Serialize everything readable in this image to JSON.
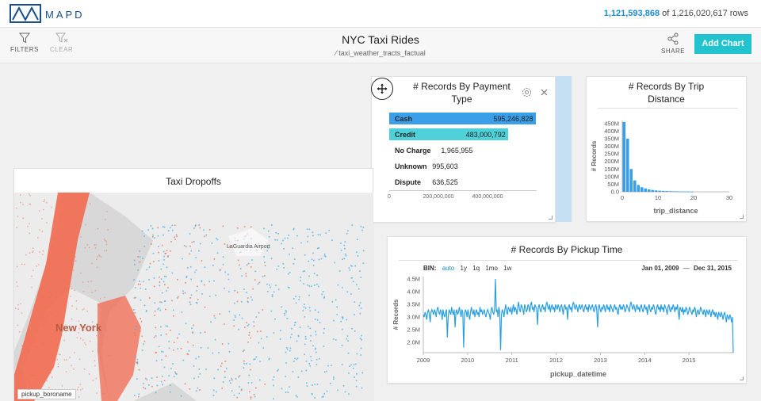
{
  "header": {
    "brand": "MAPD",
    "rows_filtered": "1,121,593,868",
    "rows_total_text": "of 1,216,020,617 rows"
  },
  "toolbar": {
    "filters_label": "FILTERS",
    "clear_label": "CLEAR",
    "share_label": "SHARE",
    "add_chart_label": "Add Chart",
    "dashboard_title": "NYC Taxi Rides",
    "table_name": "taxi_weather_tracts_factual"
  },
  "payment_card": {
    "title_line1": "# Records By Payment",
    "title_line2": "Type",
    "rows": [
      {
        "label": "Cash",
        "value_text": "595,246,828"
      },
      {
        "label": "Credit",
        "value_text": "483,000,792"
      },
      {
        "label": "No Charge",
        "value_text": "1,965,955"
      },
      {
        "label": "Unknown",
        "value_text": "995,603"
      },
      {
        "label": "Dispute",
        "value_text": "636,525"
      }
    ],
    "ticks": [
      "0",
      "200,000,000",
      "400,000,000"
    ]
  },
  "distance_card": {
    "title_line1": "# Records By Trip",
    "title_line2": "Distance",
    "xlabel": "trip_distance",
    "ylabel": "# Records"
  },
  "map_card": {
    "title": "Taxi Dropoffs",
    "label_ny": "New York",
    "label_lga": "LaGuardia Airport",
    "legend": "pickup_boroname"
  },
  "time_card": {
    "title": "# Records By Pickup Time",
    "bin_label": "BIN:",
    "bins": [
      "auto",
      "1y",
      "1q",
      "1mo",
      "1w"
    ],
    "date_start": "Jan 01, 2009",
    "date_sep": "—",
    "date_end": "Dec 31, 2015",
    "xlabel": "pickup_datetime",
    "ylabel": "# Records"
  },
  "colors": {
    "accent": "#22c2cf",
    "cash": "#3a9ee8",
    "credit": "#4fd1d9",
    "line": "#2b9fe0",
    "map_red": "#f26a50",
    "map_blue": "#3fb2e8"
  },
  "chart_data": [
    {
      "type": "bar",
      "title": "# Records By Payment Type",
      "orientation": "horizontal",
      "categories": [
        "Cash",
        "Credit",
        "No Charge",
        "Unknown",
        "Dispute"
      ],
      "values": [
        595246828,
        483000792,
        1965955,
        995603,
        636525
      ],
      "xlim": [
        0,
        600000000
      ],
      "xticks": [
        0,
        200000000,
        400000000
      ]
    },
    {
      "type": "bar",
      "title": "# Records By Trip Distance",
      "xlabel": "trip_distance",
      "ylabel": "# Records",
      "x": [
        0.5,
        1.5,
        2.5,
        3.5,
        4.5,
        5.5,
        6.5,
        7.5,
        8.5,
        9.5,
        10.5,
        11.5,
        12.5,
        13.5,
        14.5,
        15.5,
        16.5,
        17.5,
        18.5,
        19.5
      ],
      "values": [
        460000000,
        350000000,
        150000000,
        75000000,
        45000000,
        30000000,
        22000000,
        16000000,
        12000000,
        9000000,
        7000000,
        6000000,
        5000000,
        4000000,
        3500000,
        3000000,
        2500000,
        2000000,
        1500000,
        1200000
      ],
      "xlim": [
        0,
        30
      ],
      "ylim": [
        0,
        470000000
      ],
      "xticks": [
        0,
        10,
        20,
        30
      ],
      "xtick_labels": [
        "0",
        "10",
        "20",
        "30"
      ],
      "yticks": [
        0,
        50000000,
        100000000,
        150000000,
        200000000,
        250000000,
        300000000,
        350000000,
        400000000,
        450000000
      ],
      "ytick_labels": [
        "0.0",
        "50M",
        "100M",
        "150M",
        "200M",
        "250M",
        "300M",
        "350M",
        "400M",
        "450M"
      ]
    },
    {
      "type": "line",
      "title": "# Records By Pickup Time",
      "xlabel": "pickup_datetime",
      "ylabel": "# Records",
      "x_start": "2009-01",
      "interval": "1 week",
      "values": [
        3.1,
        3.0,
        3.2,
        3.1,
        2.9,
        3.2,
        3.3,
        3.1,
        2.8,
        3.2,
        3.3,
        3.2,
        3.1,
        3.3,
        3.2,
        3.0,
        3.3,
        3.4,
        3.2,
        3.1,
        3.3,
        3.2,
        2.9,
        3.3,
        3.1,
        3.0,
        3.2,
        3.3,
        2.2,
        3.0,
        3.3,
        3.2,
        3.1,
        3.4,
        3.2,
        3.1,
        3.3,
        2.6,
        3.2,
        3.3,
        3.1,
        3.2,
        3.4,
        3.2,
        3.0,
        3.3,
        3.2,
        1.8,
        3.1,
        3.3,
        3.2,
        3.0,
        3.3,
        3.1,
        2.9,
        3.2,
        3.4,
        3.2,
        3.1,
        3.3,
        3.0,
        3.2,
        3.3,
        3.1,
        3.2,
        3.0,
        3.4,
        3.2,
        3.3,
        3.1,
        3.2,
        3.3,
        3.1,
        3.0,
        3.2,
        3.3,
        3.2,
        3.1,
        2.9,
        3.3,
        3.4,
        3.2,
        3.1,
        3.3,
        4.5,
        3.2,
        3.3,
        3.0,
        3.4,
        3.2,
        1.7,
        3.1,
        3.3,
        3.2,
        3.0,
        3.3,
        3.5,
        3.2,
        3.1,
        3.4,
        3.3,
        3.2,
        3.4,
        3.1,
        3.3,
        3.5,
        3.2,
        3.4,
        3.3,
        3.1,
        3.4,
        3.6,
        3.3,
        3.2,
        3.5,
        3.4,
        3.3,
        3.1,
        3.5,
        3.4,
        3.2,
        3.3,
        3.5,
        3.4,
        3.2,
        3.5,
        3.6,
        3.3,
        3.4,
        3.2,
        3.5,
        3.4,
        3.3,
        2.7,
        3.4,
        3.5,
        3.3,
        3.2,
        3.4,
        3.5,
        3.3,
        3.4,
        3.2,
        3.5,
        3.6,
        3.4,
        3.3,
        3.5,
        3.2,
        3.4,
        3.5,
        3.3,
        3.4,
        3.2,
        3.5,
        3.4,
        3.3,
        3.5,
        3.4,
        3.2,
        3.4,
        3.5,
        3.3,
        3.1,
        3.4,
        3.5,
        3.3,
        3.4,
        2.9,
        3.4,
        3.5,
        3.3,
        3.4,
        3.2,
        3.5,
        3.6,
        3.4,
        3.3,
        3.5,
        3.4,
        3.2,
        3.4,
        3.5,
        3.3,
        3.4,
        3.5,
        3.3,
        3.2,
        3.4,
        3.5,
        3.3,
        3.4,
        3.2,
        3.5,
        3.4,
        3.3,
        3.4,
        3.5,
        3.3,
        3.2,
        3.4,
        3.5,
        3.3,
        2.6,
        3.4,
        3.5,
        3.3,
        3.2,
        3.4,
        3.3,
        3.5,
        3.4,
        3.2,
        3.4,
        3.5,
        3.3,
        3.4,
        3.2,
        3.5,
        3.4,
        3.3,
        3.2,
        3.4,
        3.5,
        3.3,
        3.4,
        3.2,
        3.1,
        3.4,
        3.5,
        3.3,
        3.4,
        3.3,
        3.5,
        3.4,
        3.2,
        3.3,
        3.5,
        3.4,
        3.3,
        3.2,
        3.5,
        3.6,
        3.4,
        3.3,
        3.5,
        3.4,
        3.2,
        3.4,
        3.5,
        3.3,
        3.4,
        3.2,
        3.4,
        3.5,
        3.3,
        3.2,
        3.4,
        3.5,
        3.3,
        3.4,
        3.1,
        3.4,
        3.5,
        3.3,
        3.2,
        3.4,
        3.3,
        3.5,
        3.4,
        3.2,
        3.1,
        3.4,
        3.5,
        3.3,
        3.4,
        3.2,
        3.5,
        3.3,
        3.4,
        3.2,
        3.5,
        3.4,
        3.3,
        3.1,
        3.4,
        3.5,
        3.3,
        3.2,
        3.4,
        3.3,
        3.5,
        3.4,
        3.2,
        3.4,
        3.3,
        3.5,
        3.2,
        2.9,
        3.4,
        3.3,
        3.2,
        3.4,
        3.1,
        3.3,
        3.2,
        3.4,
        3.3,
        3.1,
        3.2,
        3.4,
        3.3,
        3.2,
        3.1,
        3.3,
        3.2,
        3.4,
        3.3,
        3.0,
        3.2,
        3.3,
        3.1,
        3.2,
        3.4,
        3.3,
        3.2,
        3.1,
        3.3,
        3.2,
        3.0,
        3.3,
        3.2,
        3.1,
        3.3,
        3.2,
        3.0,
        3.2,
        3.3,
        3.1,
        3.2,
        3.0,
        3.2,
        3.1,
        2.9,
        3.2,
        3.1,
        3.0,
        3.2,
        3.1,
        2.9,
        3.1,
        3.2,
        3.0,
        2.8,
        3.1,
        3.0,
        2.9,
        3.1,
        3.0,
        2.8,
        3.0,
        1.6
      ],
      "ylim": [
        1.6,
        4.6
      ],
      "ytick_labels": [
        "2.0M",
        "2.5M",
        "3.0M",
        "3.5M",
        "4.0M",
        "4.5M"
      ],
      "yticks": [
        2.0,
        2.5,
        3.0,
        3.5,
        4.0,
        4.5
      ],
      "xtick_labels": [
        "2009",
        "2010",
        "2011",
        "2012",
        "2013",
        "2014",
        "2015"
      ]
    }
  ]
}
